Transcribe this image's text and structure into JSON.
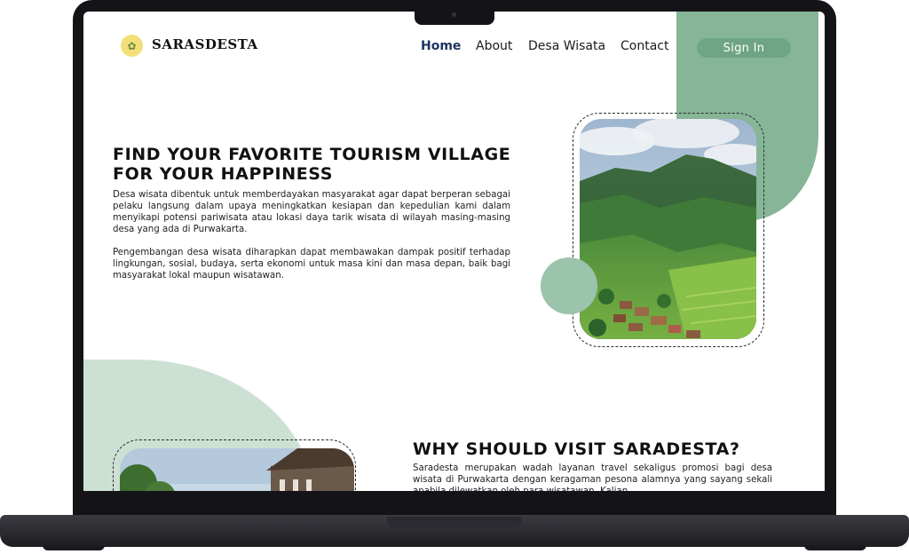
{
  "header": {
    "logo_icon": "village-logo-icon",
    "brand": "SARASDESTA",
    "nav": {
      "home": "Home",
      "about": "About",
      "desa_wisata": "Desa Wisata",
      "contact": "Contact"
    },
    "sign_in": "Sign In"
  },
  "hero": {
    "title": "FIND YOUR FAVORITE TOURISM VILLAGE FOR YOUR HAPPINESS",
    "paragraph1": "Desa wisata dibentuk untuk memberdayakan masyarakat agar dapat berperan sebagai pelaku langsung dalam upaya meningkatkan kesiapan dan kepedulian kami dalam menyikapi potensi pariwisata atau lokasi daya tarik wisata di wilayah masing-masing desa yang ada di Purwakarta.",
    "paragraph2": "Pengembangan desa wisata diharapkan dapat membawakan dampak positif terhadap lingkungan, sosial, budaya, serta ekonomi untuk masa kini dan masa depan, baik bagi masyarakat lokal maupun wisatawan."
  },
  "why": {
    "title": "WHY SHOULD VISIT SARADESTA?",
    "paragraph": "Saradesta merupakan wadah layanan travel sekaligus promosi bagi desa wisata di Purwakarta dengan keragaman pesona alamnya yang sayang sekali apabila dilewatkan oleh para wisatawan. Kalian"
  },
  "colors": {
    "accent_green": "#86b598",
    "button_green": "#6fa585",
    "light_green": "#cde0d4",
    "nav_active": "#1d3462"
  }
}
